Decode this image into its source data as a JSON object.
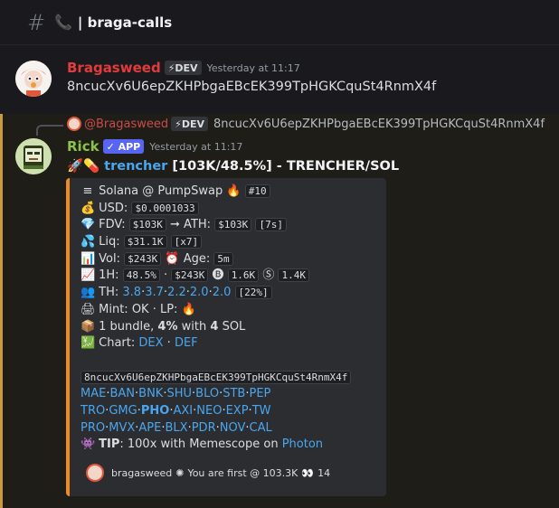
{
  "channel": {
    "name": "| braga-calls"
  },
  "msg1": {
    "username": "Bragasweed",
    "badge": "⚡DEV",
    "timestamp": "Yesterday at 11:17",
    "content": "8ncucXv6U6epZKHPbgaEBcEK399TpHGKCquSt4RnmX4f",
    "name_color": "#e23b3b"
  },
  "msg2": {
    "reply": {
      "mention": "@Bragasweed",
      "badge": "⚡DEV",
      "content": "8ncucXv6U6epZKHPbgaEBcEK399TpHGKCquSt4RnmX4f"
    },
    "username": "Rick",
    "badge": "✓ APP",
    "timestamp": "Yesterday at 11:17",
    "title_link": "trencher",
    "title_rest": "[103K/48.5%] - TRENCHER/SOL",
    "name_color": "#8bc34a"
  },
  "embed": {
    "chain": "Solana @ PumpSwap",
    "rank": "#10",
    "usd_label": "USD:",
    "usd": "$0.0001033",
    "fdv_label": "FDV:",
    "fdv": "$103K",
    "ath_label": "➞ ATH:",
    "ath": "$103K",
    "ath_time": "[7s]",
    "liq_label": "Liq:",
    "liq": "$31.1K",
    "liq_x": "[x7]",
    "vol_label": "Vol:",
    "vol": "$243K",
    "age_label": "Age:",
    "age": "5m",
    "h1_label": "1H:",
    "h1_pct": "48.5%",
    "h1_sep": "·",
    "h1_vol": "$243K",
    "h1_buys": "1.6K",
    "h1_sells": "1.4K",
    "th_label": "TH:",
    "th_values": [
      "3.8",
      "3.7",
      "2.2",
      "2.0",
      "2.0"
    ],
    "th_total": "[22%]",
    "mint": "Mint: OK · LP:",
    "bundle_pre": "1 bundle,",
    "bundle_pct": "4%",
    "bundle_mid": "with",
    "bundle_sol": "4",
    "bundle_post": "SOL",
    "chart_label": "Chart:",
    "chart_links": [
      "DEX",
      "DEF"
    ],
    "address": "8ncucXv6U6epZKHPbgaEBcEK399TpHGKCquSt4RnmX4f",
    "bots_row1": [
      "MAE",
      "BAN",
      "BNK",
      "SHU",
      "BLO",
      "STB",
      "PEP"
    ],
    "bots_row2": [
      "TRO",
      "GMG",
      "PHO",
      "AXI",
      "NEO",
      "EXP",
      "TW"
    ],
    "bots_row3": [
      "PRO",
      "MVX",
      "APE",
      "BLX",
      "PDR",
      "NOV",
      "CAL"
    ],
    "tip_label": "TIP",
    "tip_text": ": 100x with Memescope on",
    "tip_link": "Photon",
    "footer_user": "bragasweed",
    "footer_text": "You are first @ 103.3K",
    "footer_count": "14",
    "accent": "#f08a24"
  }
}
